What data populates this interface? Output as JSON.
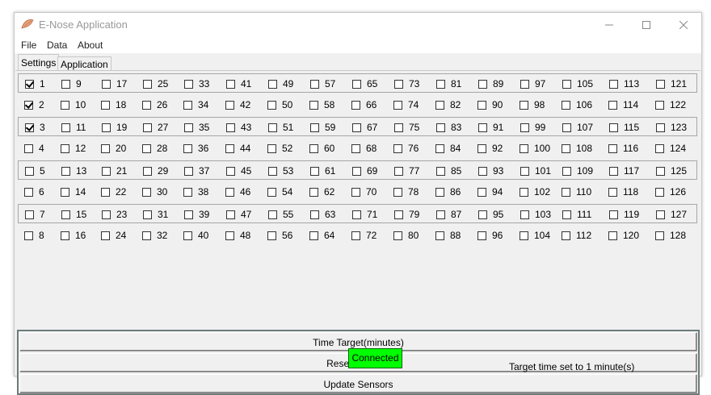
{
  "window": {
    "title": "E-Nose Application",
    "icon": "nose-icon"
  },
  "menu": [
    "File",
    "Data",
    "About"
  ],
  "tabs": [
    {
      "label": "Settings",
      "active": true
    },
    {
      "label": "Application",
      "active": false
    }
  ],
  "sensors": {
    "rows": [
      [
        {
          "label": "1",
          "checked": true
        },
        {
          "label": "9",
          "checked": false
        },
        {
          "label": "17",
          "checked": false
        },
        {
          "label": "25",
          "checked": false
        },
        {
          "label": "33",
          "checked": false
        },
        {
          "label": "41",
          "checked": false
        },
        {
          "label": "49",
          "checked": false
        },
        {
          "label": "57",
          "checked": false
        },
        {
          "label": "65",
          "checked": false
        },
        {
          "label": "73",
          "checked": false
        },
        {
          "label": "81",
          "checked": false
        },
        {
          "label": "89",
          "checked": false
        },
        {
          "label": "97",
          "checked": false
        },
        {
          "label": "105",
          "checked": false
        },
        {
          "label": "113",
          "checked": false
        },
        {
          "label": "121",
          "checked": false
        }
      ],
      [
        {
          "label": "2",
          "checked": true
        },
        {
          "label": "10",
          "checked": false
        },
        {
          "label": "18",
          "checked": false
        },
        {
          "label": "26",
          "checked": false
        },
        {
          "label": "34",
          "checked": false
        },
        {
          "label": "42",
          "checked": false
        },
        {
          "label": "50",
          "checked": false
        },
        {
          "label": "58",
          "checked": false
        },
        {
          "label": "66",
          "checked": false
        },
        {
          "label": "74",
          "checked": false
        },
        {
          "label": "82",
          "checked": false
        },
        {
          "label": "90",
          "checked": false
        },
        {
          "label": "98",
          "checked": false
        },
        {
          "label": "106",
          "checked": false
        },
        {
          "label": "114",
          "checked": false
        },
        {
          "label": "122",
          "checked": false
        }
      ],
      [
        {
          "label": "3",
          "checked": true
        },
        {
          "label": "11",
          "checked": false
        },
        {
          "label": "19",
          "checked": false
        },
        {
          "label": "27",
          "checked": false
        },
        {
          "label": "35",
          "checked": false
        },
        {
          "label": "43",
          "checked": false
        },
        {
          "label": "51",
          "checked": false
        },
        {
          "label": "59",
          "checked": false
        },
        {
          "label": "67",
          "checked": false
        },
        {
          "label": "75",
          "checked": false
        },
        {
          "label": "83",
          "checked": false
        },
        {
          "label": "91",
          "checked": false
        },
        {
          "label": "99",
          "checked": false
        },
        {
          "label": "107",
          "checked": false
        },
        {
          "label": "115",
          "checked": false
        },
        {
          "label": "123",
          "checked": false
        }
      ],
      [
        {
          "label": "4",
          "checked": false
        },
        {
          "label": "12",
          "checked": false
        },
        {
          "label": "20",
          "checked": false
        },
        {
          "label": "28",
          "checked": false
        },
        {
          "label": "36",
          "checked": false
        },
        {
          "label": "44",
          "checked": false
        },
        {
          "label": "52",
          "checked": false
        },
        {
          "label": "60",
          "checked": false
        },
        {
          "label": "68",
          "checked": false
        },
        {
          "label": "76",
          "checked": false
        },
        {
          "label": "84",
          "checked": false
        },
        {
          "label": "92",
          "checked": false
        },
        {
          "label": "100",
          "checked": false
        },
        {
          "label": "108",
          "checked": false
        },
        {
          "label": "116",
          "checked": false
        },
        {
          "label": "124",
          "checked": false
        }
      ],
      [
        {
          "label": "5",
          "checked": false
        },
        {
          "label": "13",
          "checked": false
        },
        {
          "label": "21",
          "checked": false
        },
        {
          "label": "29",
          "checked": false
        },
        {
          "label": "37",
          "checked": false
        },
        {
          "label": "45",
          "checked": false
        },
        {
          "label": "53",
          "checked": false
        },
        {
          "label": "61",
          "checked": false
        },
        {
          "label": "69",
          "checked": false
        },
        {
          "label": "77",
          "checked": false
        },
        {
          "label": "85",
          "checked": false
        },
        {
          "label": "93",
          "checked": false
        },
        {
          "label": "101",
          "checked": false
        },
        {
          "label": "109",
          "checked": false
        },
        {
          "label": "117",
          "checked": false
        },
        {
          "label": "125",
          "checked": false
        }
      ],
      [
        {
          "label": "6",
          "checked": false
        },
        {
          "label": "14",
          "checked": false
        },
        {
          "label": "22",
          "checked": false
        },
        {
          "label": "30",
          "checked": false
        },
        {
          "label": "38",
          "checked": false
        },
        {
          "label": "46",
          "checked": false
        },
        {
          "label": "54",
          "checked": false
        },
        {
          "label": "62",
          "checked": false
        },
        {
          "label": "70",
          "checked": false
        },
        {
          "label": "78",
          "checked": false
        },
        {
          "label": "86",
          "checked": false
        },
        {
          "label": "94",
          "checked": false
        },
        {
          "label": "102",
          "checked": false
        },
        {
          "label": "110",
          "checked": false
        },
        {
          "label": "118",
          "checked": false
        },
        {
          "label": "126",
          "checked": false
        }
      ],
      [
        {
          "label": "7",
          "checked": false
        },
        {
          "label": "15",
          "checked": false
        },
        {
          "label": "23",
          "checked": false
        },
        {
          "label": "31",
          "checked": false
        },
        {
          "label": "39",
          "checked": false
        },
        {
          "label": "47",
          "checked": false
        },
        {
          "label": "55",
          "checked": false
        },
        {
          "label": "63",
          "checked": false
        },
        {
          "label": "71",
          "checked": false
        },
        {
          "label": "79",
          "checked": false
        },
        {
          "label": "87",
          "checked": false
        },
        {
          "label": "95",
          "checked": false
        },
        {
          "label": "103",
          "checked": false
        },
        {
          "label": "111",
          "checked": false
        },
        {
          "label": "119",
          "checked": false
        },
        {
          "label": "127",
          "checked": false
        }
      ],
      [
        {
          "label": "8",
          "checked": false
        },
        {
          "label": "16",
          "checked": false
        },
        {
          "label": "24",
          "checked": false
        },
        {
          "label": "32",
          "checked": false
        },
        {
          "label": "40",
          "checked": false
        },
        {
          "label": "48",
          "checked": false
        },
        {
          "label": "56",
          "checked": false
        },
        {
          "label": "64",
          "checked": false
        },
        {
          "label": "72",
          "checked": false
        },
        {
          "label": "80",
          "checked": false
        },
        {
          "label": "88",
          "checked": false
        },
        {
          "label": "96",
          "checked": false
        },
        {
          "label": "104",
          "checked": false
        },
        {
          "label": "112",
          "checked": false
        },
        {
          "label": "120",
          "checked": false
        },
        {
          "label": "128",
          "checked": false
        }
      ]
    ]
  },
  "actions": {
    "time_target_label": "Time Target(minutes)",
    "reset_label": "Reset Sensors",
    "update_label": "Update Sensors"
  },
  "status": {
    "connection_label": "Connected",
    "connection_color": "#00ff00",
    "target_message": "Target time set to 1 minute(s)"
  }
}
